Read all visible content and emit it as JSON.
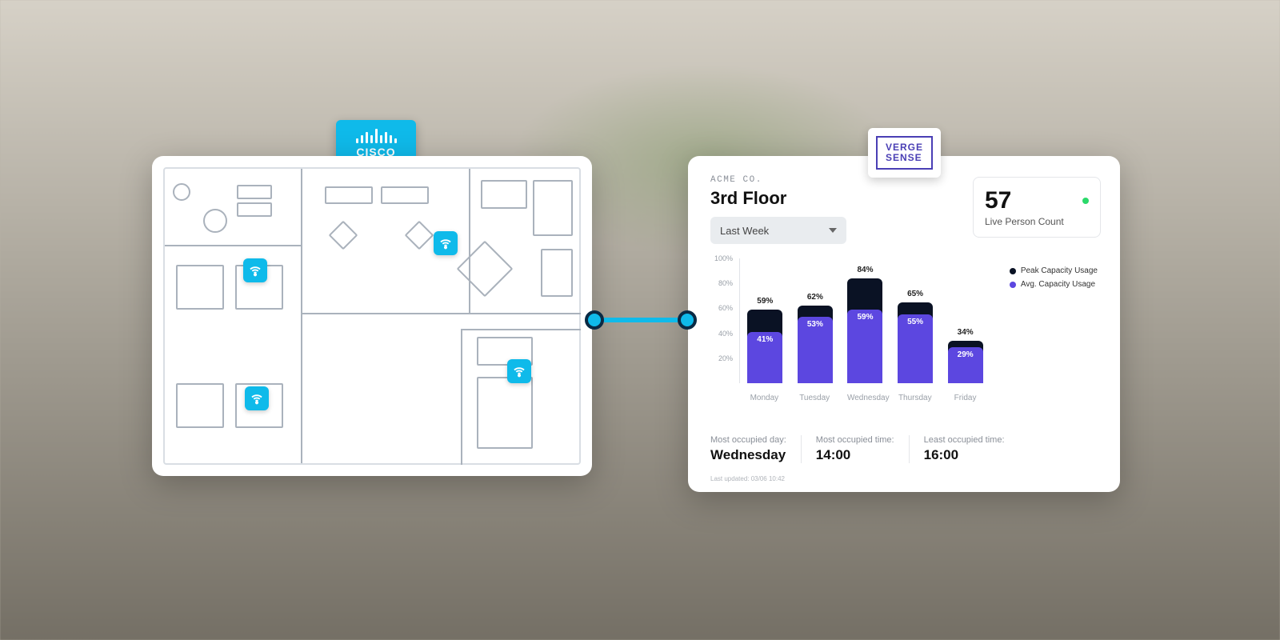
{
  "brands": {
    "cisco": "CISCO",
    "verge_line1": "VERGE",
    "verge_line2": "SENSE"
  },
  "floorplan": {
    "wifi_markers": 4
  },
  "analytics": {
    "company": "ACME CO.",
    "floor": "3rd Floor",
    "dropdown_selected": "Last Week",
    "live_count": "57",
    "live_label": "Live Person Count",
    "legend": {
      "peak": "Peak Capacity Usage",
      "avg": "Avg. Capacity Usage",
      "peak_color": "#0a1224",
      "avg_color": "#5c47e0"
    },
    "yticks": [
      "100%",
      "80%",
      "60%",
      "40%",
      "20%"
    ],
    "stats": {
      "most_day_lbl": "Most occupied day:",
      "most_day_val": "Wednesday",
      "most_time_lbl": "Most occupied time:",
      "most_time_val": "14:00",
      "least_time_lbl": "Least occupied time:",
      "least_time_val": "16:00"
    },
    "last_updated": "Last updated: 03/06 10:42"
  },
  "chart_data": {
    "type": "bar",
    "categories": [
      "Monday",
      "Tuesday",
      "Wednesday",
      "Thursday",
      "Friday"
    ],
    "series": [
      {
        "name": "Peak Capacity Usage",
        "values": [
          59,
          62,
          84,
          65,
          34
        ]
      },
      {
        "name": "Avg. Capacity Usage",
        "values": [
          41,
          53,
          59,
          55,
          29
        ]
      }
    ],
    "ylabel": "",
    "xlabel": "",
    "ylim": [
      0,
      100
    ],
    "peak_labels": [
      "59%",
      "62%",
      "84%",
      "65%",
      "34%"
    ],
    "avg_labels": [
      "41%",
      "53%",
      "59%",
      "55%",
      "29%"
    ]
  }
}
